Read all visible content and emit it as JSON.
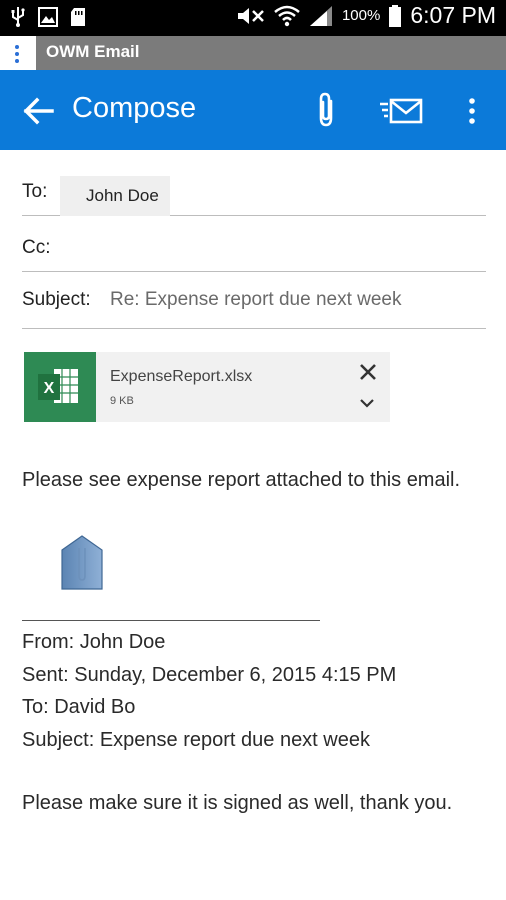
{
  "status_bar": {
    "icons": [
      "usb-icon",
      "image-icon",
      "sd-card-icon",
      "mute-icon",
      "wifi-icon",
      "signal-icon",
      "battery-icon"
    ],
    "battery": "100%",
    "time": "6:07 PM"
  },
  "app_bar": {
    "title": "OWM Email"
  },
  "toolbar": {
    "title": "Compose",
    "actions": [
      "back-icon",
      "attach-icon",
      "send-icon",
      "more-icon"
    ],
    "accent_color": "#0c7ad9"
  },
  "compose": {
    "to_label": "To:",
    "to_recipient": "John Doe",
    "cc_label": "Cc:",
    "subject_label": "Subject:",
    "subject_value": "Re: Expense report due next week"
  },
  "attachment": {
    "file_name": "ExpenseReport.xlsx",
    "file_size": "9 KB",
    "icon": "excel-icon",
    "icon_color": "#2e8a54"
  },
  "body": {
    "message": "Please see expense report attached to this email.",
    "quoted": {
      "from": "From: John Doe",
      "sent": "Sent: Sunday, December 6, 2015 4:15 PM",
      "to": "To: David Bo",
      "subject": "Subject: Expense report due next week"
    },
    "original_message": "Please make sure it is signed as well, thank you."
  }
}
